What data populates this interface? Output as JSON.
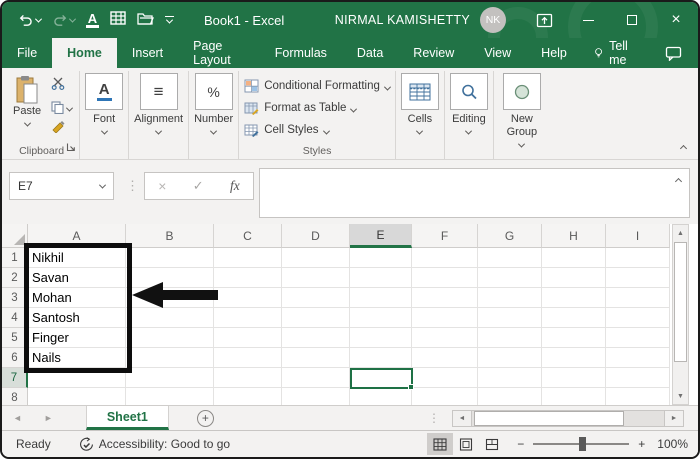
{
  "window": {
    "title": "Book1  -  Excel",
    "user": "NIRMAL KAMISHETTY",
    "avatar": "NK"
  },
  "tabs": {
    "items": [
      "File",
      "Home",
      "Insert",
      "Page Layout",
      "Formulas",
      "Data",
      "Review",
      "View",
      "Help"
    ],
    "active": "Home",
    "tell_me": "Tell me"
  },
  "ribbon": {
    "paste": "Paste",
    "font": "Font",
    "alignment": "Alignment",
    "number": "Number",
    "conditional_formatting": "Conditional Formatting",
    "format_as_table": "Format as Table",
    "cell_styles": "Cell Styles",
    "cells": "Cells",
    "editing": "Editing",
    "new_group": "New Group",
    "clipboard_label": "Clipboard",
    "styles_label": "Styles"
  },
  "formula_bar": {
    "name_box": "E7",
    "fx": "fx"
  },
  "sheet": {
    "columns": [
      "A",
      "B",
      "C",
      "D",
      "E",
      "F",
      "G",
      "H",
      "I"
    ],
    "rows": [
      "1",
      "2",
      "3",
      "4",
      "5",
      "6",
      "7",
      "8"
    ],
    "cells": [
      "Nikhil",
      "Savan",
      "Mohan",
      "Santosh",
      "Finger",
      "Nails"
    ],
    "selected_cell": "E7",
    "active_sheet": "Sheet1"
  },
  "status_bar": {
    "mode": "Ready",
    "accessibility": "Accessibility: Good to go",
    "zoom_level": "100%"
  },
  "icons": {
    "font_color": "A",
    "font": "A",
    "alignment": "≡",
    "percent": "%",
    "cancel": "×",
    "enter": "✓",
    "dots": "⋮",
    "left": "◄",
    "right": "►",
    "up": "▲",
    "down": "▼",
    "plus": "+",
    "minus": "−",
    "close": "×"
  },
  "colors": {
    "excel_green": "#217346",
    "active_cell_border": "#1e7145",
    "arrow_black": "#111111"
  }
}
